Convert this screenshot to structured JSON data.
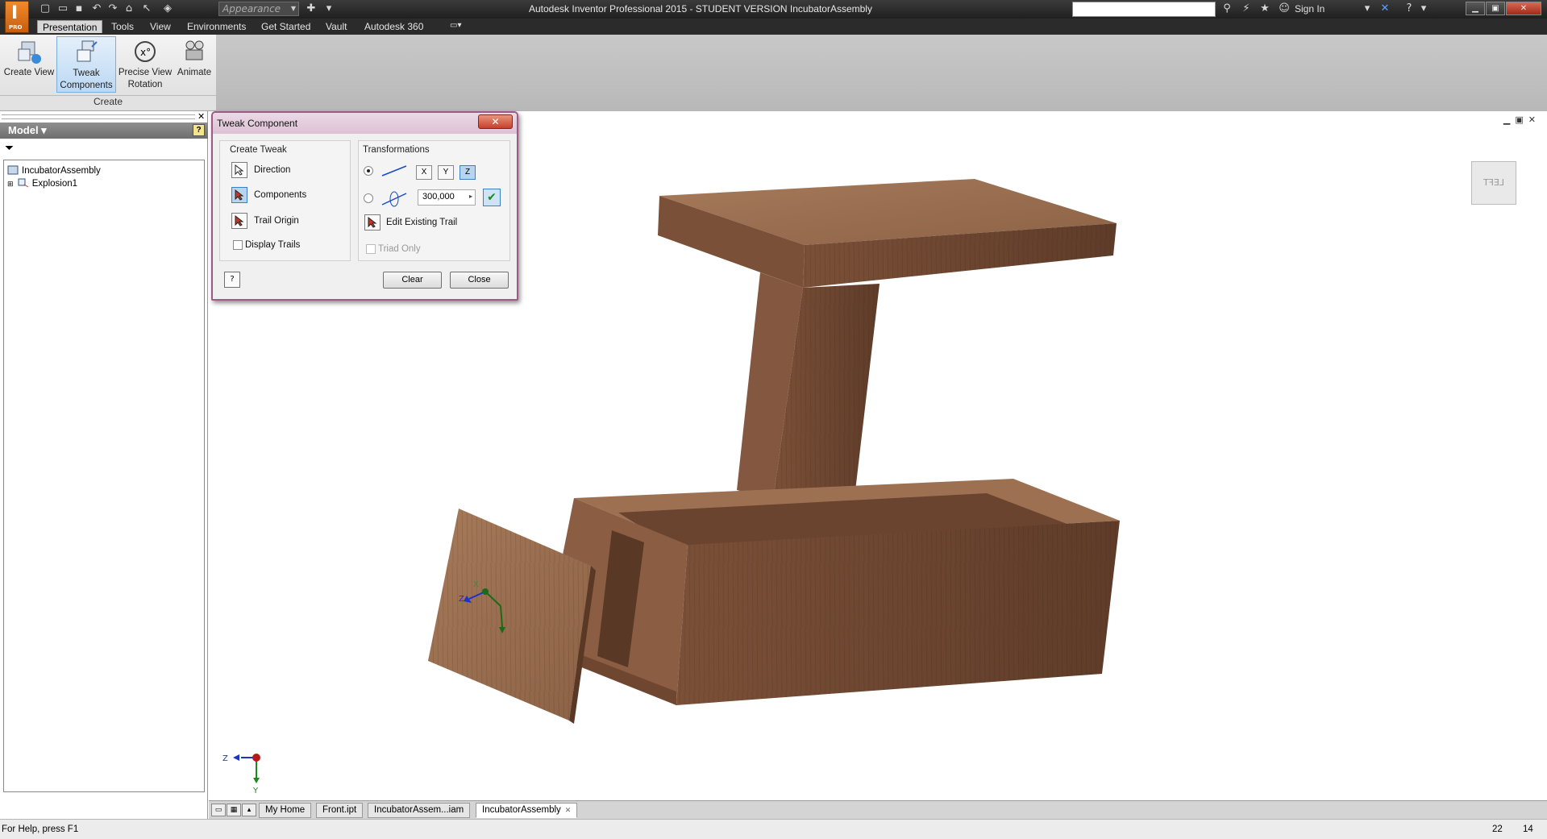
{
  "titlebar": {
    "window_title": "Autodesk Inventor Professional 2015 - STUDENT VERSION   IncubatorAssembly",
    "appearance_placeholder": "Appearance",
    "sign_in": "Sign In",
    "logo_pro": "PRO"
  },
  "menu": {
    "items": [
      "Presentation",
      "Tools",
      "View",
      "Environments",
      "Get Started",
      "Vault",
      "Autodesk 360"
    ]
  },
  "ribbon": {
    "buttons": {
      "create_view": "Create View",
      "tweak_components_1": "Tweak",
      "tweak_components_2": "Components",
      "precise_view_1": "Precise View",
      "precise_view_2": "Rotation",
      "animate": "Animate"
    },
    "panel_label": "Create"
  },
  "browser": {
    "header": "Model",
    "tree": [
      "IncubatorAssembly",
      "Explosion1"
    ]
  },
  "dialog": {
    "title": "Tweak Component",
    "create_tweak": {
      "title": "Create Tweak",
      "direction": "Direction",
      "components": "Components",
      "trail_origin": "Trail Origin",
      "display_trails": "Display Trails"
    },
    "transformations": {
      "title": "Transformations",
      "axis_x": "X",
      "axis_y": "Y",
      "axis_z": "Z",
      "value": "300,000",
      "edit_existing_trail": "Edit Existing Trail",
      "triad_only": "Triad Only"
    },
    "clear": "Clear",
    "close": "Close"
  },
  "viewport": {
    "viewcube_label": "LEFT",
    "triad_z": "Z",
    "triad_y": "Y",
    "gizmo_x": "X",
    "gizmo_z": "Z"
  },
  "tabs": [
    {
      "label": "My Home"
    },
    {
      "label": "Front.ipt"
    },
    {
      "label": "IncubatorAssem...iam"
    },
    {
      "label": "IncubatorAssembly",
      "active": true
    }
  ],
  "status": {
    "help": "For Help, press F1",
    "num1": "22",
    "num2": "14"
  },
  "colors": {
    "wood_dark": "#6b4630",
    "wood_mid": "#8a5e42",
    "wood_light": "#a77a5b",
    "dialog_border": "#a05a87"
  }
}
